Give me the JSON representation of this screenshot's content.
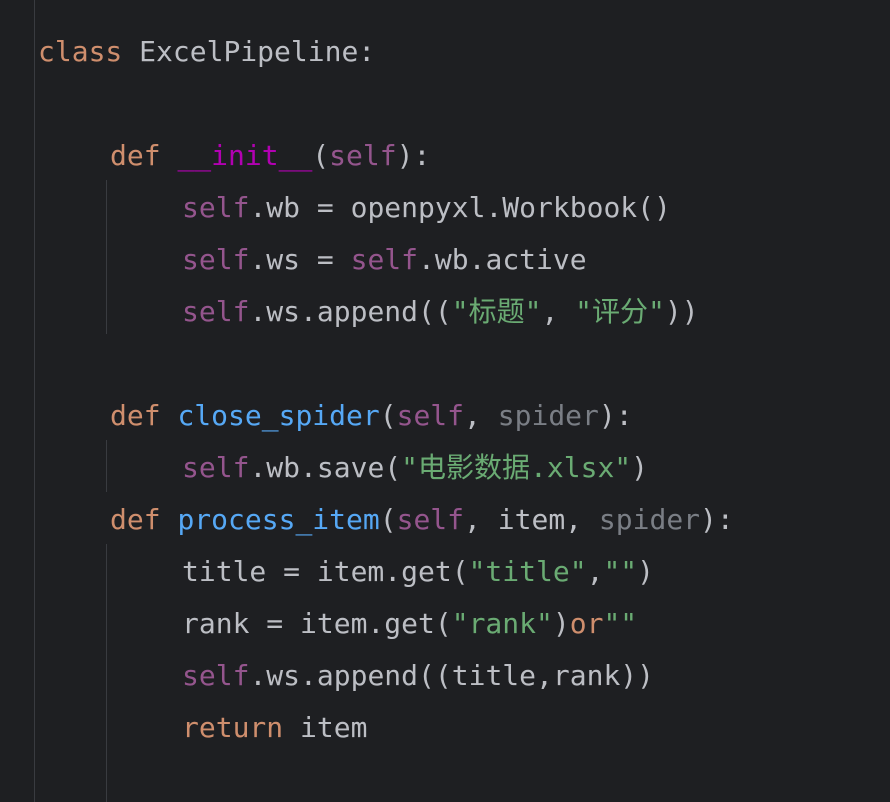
{
  "editor": {
    "background": "#1e1f22",
    "colors": {
      "keyword": "#cf8e6d",
      "self": "#94558d",
      "magic_method": "#b200b2",
      "function_name": "#56a8f5",
      "string": "#6aab73",
      "unused_param": "#7a7e85",
      "default_text": "#bcbec4",
      "indent_guide": "#393b40"
    },
    "lines": [
      {
        "indent": 0,
        "tokens": [
          {
            "t": "class",
            "k": "kw"
          },
          {
            "t": " ExcelPipeline:",
            "k": "plain"
          }
        ]
      },
      {
        "indent": 0,
        "tokens": []
      },
      {
        "indent": 1,
        "tokens": [
          {
            "t": "def",
            "k": "kw"
          },
          {
            "t": " ",
            "k": "plain"
          },
          {
            "t": "__init__",
            "k": "magic"
          },
          {
            "t": "(",
            "k": "plain"
          },
          {
            "t": "self",
            "k": "self"
          },
          {
            "t": "):",
            "k": "plain"
          }
        ]
      },
      {
        "indent": 2,
        "tokens": [
          {
            "t": "self",
            "k": "self"
          },
          {
            "t": ".wb = openpyxl.Workbook()",
            "k": "plain"
          }
        ]
      },
      {
        "indent": 2,
        "tokens": [
          {
            "t": "self",
            "k": "self"
          },
          {
            "t": ".ws = ",
            "k": "plain"
          },
          {
            "t": "self",
            "k": "self"
          },
          {
            "t": ".wb.active",
            "k": "plain"
          }
        ]
      },
      {
        "indent": 2,
        "tokens": [
          {
            "t": "self",
            "k": "self"
          },
          {
            "t": ".ws.append((",
            "k": "plain"
          },
          {
            "t": "\"标题\"",
            "k": "str"
          },
          {
            "t": ", ",
            "k": "plain"
          },
          {
            "t": "\"评分\"",
            "k": "str"
          },
          {
            "t": "))",
            "k": "plain"
          }
        ]
      },
      {
        "indent": 0,
        "tokens": []
      },
      {
        "indent": 1,
        "tokens": [
          {
            "t": "def",
            "k": "kw"
          },
          {
            "t": " ",
            "k": "plain"
          },
          {
            "t": "close_spider",
            "k": "fn"
          },
          {
            "t": "(",
            "k": "plain"
          },
          {
            "t": "self",
            "k": "self"
          },
          {
            "t": ", ",
            "k": "plain"
          },
          {
            "t": "spider",
            "k": "unused"
          },
          {
            "t": "):",
            "k": "plain"
          }
        ]
      },
      {
        "indent": 2,
        "tokens": [
          {
            "t": "self",
            "k": "self"
          },
          {
            "t": ".wb.save(",
            "k": "plain"
          },
          {
            "t": "\"电影数据.xlsx\"",
            "k": "str"
          },
          {
            "t": ")",
            "k": "plain"
          }
        ]
      },
      {
        "indent": 1,
        "tokens": [
          {
            "t": "def",
            "k": "kw"
          },
          {
            "t": " ",
            "k": "plain"
          },
          {
            "t": "process_item",
            "k": "fn"
          },
          {
            "t": "(",
            "k": "plain"
          },
          {
            "t": "self",
            "k": "self"
          },
          {
            "t": ", item, ",
            "k": "plain"
          },
          {
            "t": "spider",
            "k": "unused"
          },
          {
            "t": "):",
            "k": "plain"
          }
        ]
      },
      {
        "indent": 2,
        "tokens": [
          {
            "t": "title = item.get(",
            "k": "plain"
          },
          {
            "t": "\"title\"",
            "k": "str"
          },
          {
            "t": ",",
            "k": "plain"
          },
          {
            "t": "\"\"",
            "k": "str"
          },
          {
            "t": ")",
            "k": "plain"
          }
        ]
      },
      {
        "indent": 2,
        "tokens": [
          {
            "t": "rank = item.get(",
            "k": "plain"
          },
          {
            "t": "\"rank\"",
            "k": "str"
          },
          {
            "t": ")",
            "k": "plain"
          },
          {
            "t": "or",
            "k": "kw"
          },
          {
            "t": "\"\"",
            "k": "str"
          }
        ]
      },
      {
        "indent": 2,
        "tokens": [
          {
            "t": "self",
            "k": "self"
          },
          {
            "t": ".ws.append((title,rank))",
            "k": "plain"
          }
        ]
      },
      {
        "indent": 2,
        "tokens": [
          {
            "t": "return",
            "k": "kw"
          },
          {
            "t": " item",
            "k": "plain"
          }
        ]
      },
      {
        "indent": 0,
        "tokens": []
      }
    ]
  }
}
